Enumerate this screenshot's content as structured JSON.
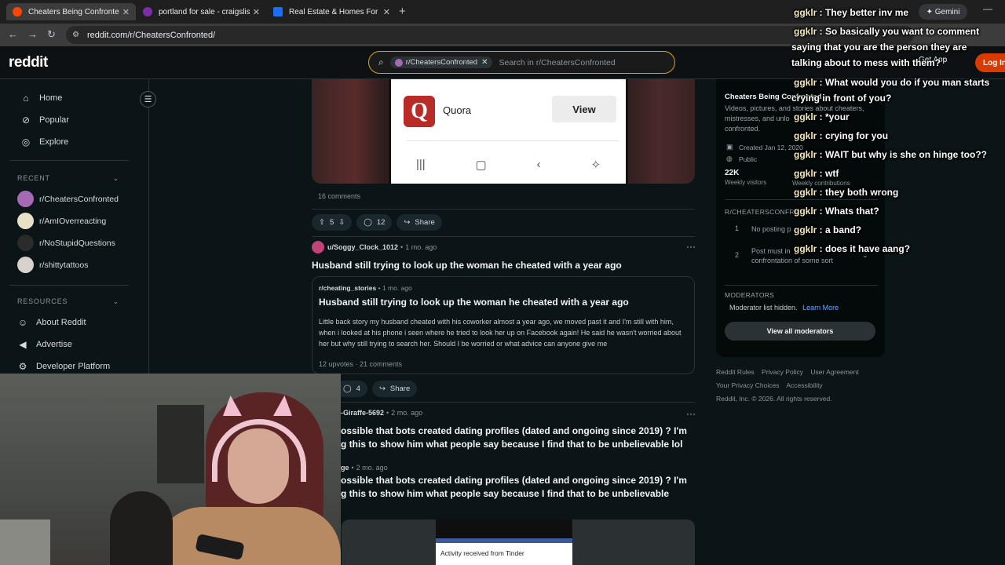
{
  "browser": {
    "tabs": [
      {
        "label": "Cheaters Being Confronted",
        "active": true,
        "icon_color": "#ff4500"
      },
      {
        "label": "portland for sale - craigslist",
        "active": false,
        "icon_color": "#7b2ea8"
      },
      {
        "label": "Real Estate & Homes For Sale",
        "active": false,
        "icon_color": "#1b6ff5"
      }
    ],
    "new_tab": "+",
    "gemini_label": "✦ Gemini",
    "url": "reddit.com/r/CheatersConfronted/"
  },
  "header": {
    "logo": "reddit",
    "search_chip": "r/CheatersConfronted",
    "search_placeholder": "Search in r/CheatersConfronted",
    "get_app": "Get App",
    "login": "Log In"
  },
  "sidebar": {
    "nav": [
      {
        "label": "Home",
        "icon": "home-icon"
      },
      {
        "label": "Popular",
        "icon": "popular-icon"
      },
      {
        "label": "Explore",
        "icon": "explore-icon"
      }
    ],
    "recent_heading": "RECENT",
    "recent": [
      {
        "label": "r/CheatersConfronted",
        "color": "#a56ab5"
      },
      {
        "label": "r/AmIOverreacting",
        "color": "#e8e1c8"
      },
      {
        "label": "r/NoStupidQuestions",
        "color": "#2b2b2b"
      },
      {
        "label": "r/shittytattoos",
        "color": "#d7d2cc"
      }
    ],
    "resources_heading": "RESOURCES",
    "resources": [
      {
        "label": "About Reddit",
        "icon": "reddit-icon"
      },
      {
        "label": "Advertise",
        "icon": "megaphone-icon"
      },
      {
        "label": "Developer Platform",
        "icon": "gear-icon"
      }
    ]
  },
  "feed": {
    "post0": {
      "media_brand": "Quora",
      "media_button": "View",
      "comments_text": "16 comments",
      "votes": "5",
      "comments": "12",
      "share": "Share"
    },
    "post1": {
      "author": "u/Soggy_Clock_1012",
      "time": "1 mo. ago",
      "title": "Husband still trying to look up the woman he cheated with a year ago",
      "xpost_sub": "r/cheating_stories",
      "xpost_time": "1 mo. ago",
      "xpost_title": "Husband still trying to look up the woman he cheated with a year ago",
      "xpost_body": "Little back story my husband cheated with his coworker almost a year ago, we moved past it and I'm still with him, when i looked at his phone i seen where he tried to look her up on Facebook again! He said he wasn't worried about her but why still trying to search her. Should I be worried or what advice can anyone give me",
      "xpost_stats": "12 upvotes · 21 comments",
      "comments": "4",
      "share": "Share"
    },
    "post2": {
      "author": "-Giraffe-5692",
      "time": "2 mo. ago",
      "title_line1": "ossible that bots created dating profiles (dated and ongoing since 2019) ? I'm",
      "title_line2": "g this to show him what people say because I find that to be unbelievable lol",
      "xpost_sub": "ge",
      "xpost_time": "2 mo. ago",
      "xpost_title_line1": "ossible that bots created dating profiles (dated and ongoing since 2019) ? I'm",
      "xpost_title_line2": "g this to show him what people say because I find that to be unbelievable",
      "media_notification": "Activity received from Tinder"
    }
  },
  "community": {
    "title": "Cheaters Being Confronted",
    "description": "Videos, pictures, and stories about cheaters, mistresses, and unlo",
    "description_tail": "confronted.",
    "created": "Created Jan 12, 2020",
    "visibility": "Public",
    "visitors_value": "22K",
    "visitors_label": "Weekly visitors",
    "contrib_label": "Weekly contributions",
    "rules_heading": "R/CHEATERSCONFRON",
    "rules": [
      {
        "num": "1",
        "text": "No posting p"
      },
      {
        "num": "2",
        "text": "Post must in",
        "text2": "confrontation of some sort"
      }
    ],
    "moderators_heading": "MODERATORS",
    "mod_hidden": "Moderator list hidden.",
    "learn_more": "Learn More",
    "view_all_mods": "View all moderators",
    "footer": {
      "links_row1": [
        "Reddit Rules",
        "Privacy Policy",
        "User Agreement"
      ],
      "links_row2": [
        "Your Privacy Choices",
        "Accessibility"
      ],
      "copyright": "Reddit, Inc. © 2026. All rights reserved."
    }
  },
  "chat": [
    {
      "user": "ggklr",
      "msg": "They better inv me"
    },
    {
      "user": "ggklr",
      "msg": "So basically you want to comment",
      "cont": [
        "saying that you are the person they are",
        "talking about to mess with them?"
      ]
    },
    {
      "user": "ggklr",
      "msg": "What would you do if you man starts",
      "cont": [
        "crying in front of you?"
      ]
    },
    {
      "user": "ggklr",
      "msg": "*your"
    },
    {
      "user": "ggklr",
      "msg": "crying for you"
    },
    {
      "user": "ggklr",
      "msg": "WAIT but why is she on hinge too??"
    },
    {
      "user": "ggklr",
      "msg": "wtf"
    },
    {
      "user": "ggklr",
      "msg": "they both wrong"
    },
    {
      "user": "ggklr",
      "msg": "Whats that?"
    },
    {
      "user": "ggklr",
      "msg": "a band?"
    },
    {
      "user": "ggklr",
      "msg": "does it have aang?"
    }
  ]
}
